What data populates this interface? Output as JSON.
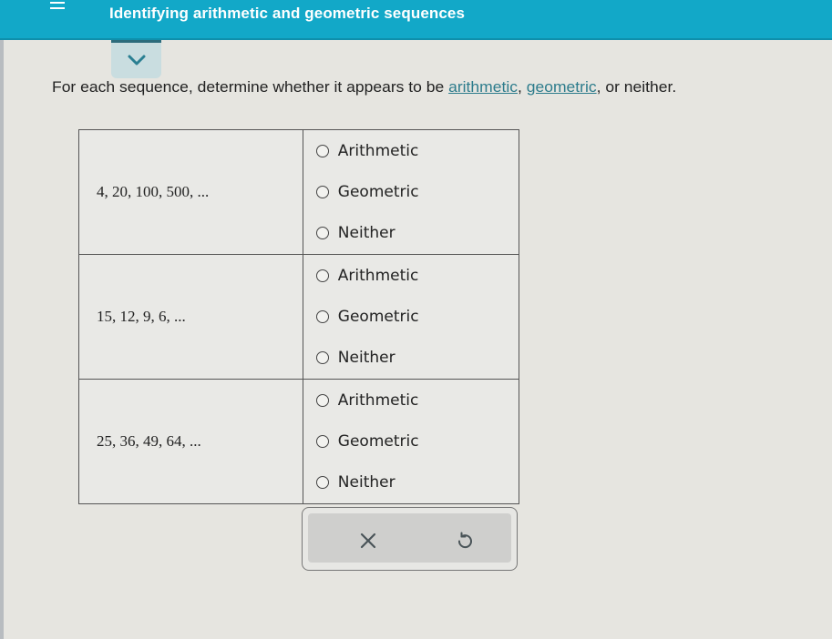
{
  "header": {
    "title": "Identifying arithmetic and geometric sequences",
    "menu_icon": "hamburger-menu-icon",
    "background_color": "#12a8c8"
  },
  "collapse_tab": {
    "icon": "chevron-down-icon"
  },
  "instructions": {
    "prefix": "For each sequence, determine whether it appears to be ",
    "link1": "arithmetic",
    "sep": ", ",
    "link2": "geometric",
    "suffix": ", or neither.",
    "link_color": "#2d7c8c"
  },
  "rows": [
    {
      "sequence": "4, 20, 100, 500, ...",
      "options": [
        "Arithmetic",
        "Geometric",
        "Neither"
      ],
      "selected": null
    },
    {
      "sequence": "15, 12, 9, 6, ...",
      "options": [
        "Arithmetic",
        "Geometric",
        "Neither"
      ],
      "selected": null
    },
    {
      "sequence": "25, 36, 49, 64, ...",
      "options": [
        "Arithmetic",
        "Geometric",
        "Neither"
      ],
      "selected": null
    }
  ],
  "actions": {
    "clear_icon": "close-icon",
    "undo_icon": "undo-icon"
  }
}
